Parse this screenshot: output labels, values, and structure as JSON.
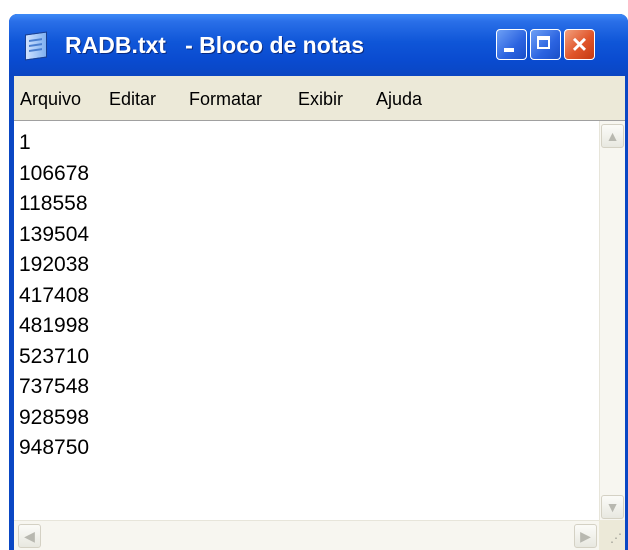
{
  "window": {
    "title": "RADB.txt   - Bloco de notas",
    "app_icon": "notepad-icon",
    "controls": {
      "minimize": "minimize-icon",
      "maximize": "maximize-icon",
      "close": "×"
    }
  },
  "menubar": {
    "items": [
      {
        "label": "Arquivo"
      },
      {
        "label": "Editar"
      },
      {
        "label": "Formatar"
      },
      {
        "label": "Exibir"
      },
      {
        "label": "Ajuda"
      }
    ]
  },
  "editor": {
    "lines": [
      "1",
      "106678",
      "118558",
      "139504",
      "192038",
      "417408",
      "481998",
      "523710",
      "737548",
      "928598",
      "948750"
    ]
  },
  "scrollbars": {
    "up_arrow": "▲",
    "down_arrow": "▼",
    "left_arrow": "◀",
    "right_arrow": "▶",
    "grip": "⋰"
  },
  "colors": {
    "titlebar": "#0a4bd0",
    "menubar": "#ece9d8",
    "close_button": "#e0552a"
  }
}
